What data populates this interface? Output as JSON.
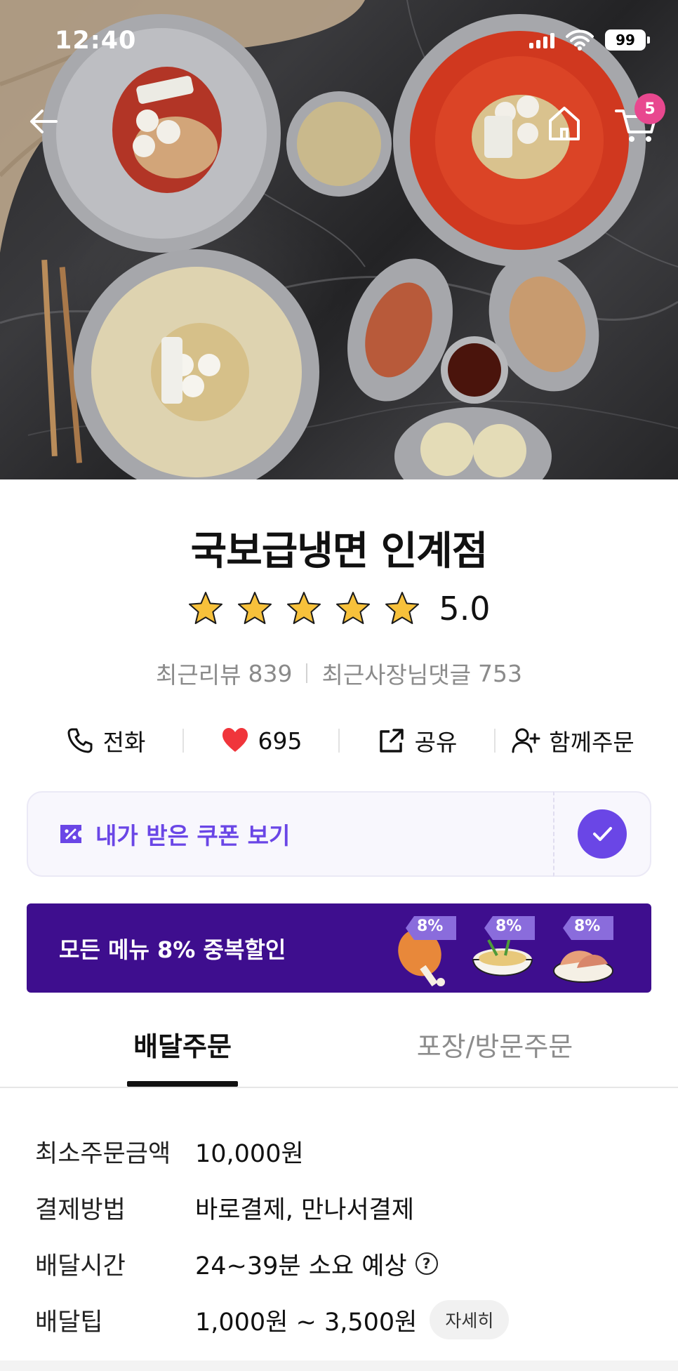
{
  "status_bar": {
    "time": "12:40",
    "battery": "99"
  },
  "nav": {
    "back_icon": "arrow-left-icon",
    "home_icon": "home-icon",
    "cart_icon": "cart-icon",
    "cart_count": "5"
  },
  "hero": {
    "image": "food-photo"
  },
  "store": {
    "name": "국보급냉면 인계점",
    "rating": "5.0",
    "stars": 5,
    "recent_reviews_label": "최근리뷰",
    "recent_reviews_count": "839",
    "owner_replies_label": "최근사장님댓글",
    "owner_replies_count": "753"
  },
  "actions": {
    "call": "전화",
    "likes": "695",
    "share": "공유",
    "group_order": "함께주문"
  },
  "coupon": {
    "label": "내가 받은 쿠폰 보기"
  },
  "promo": {
    "text": "모든 메뉴 8% 중복할인",
    "badge": "8%"
  },
  "tabs": {
    "delivery": "배달주문",
    "pickup": "포장/방문주문"
  },
  "info": [
    {
      "label": "최소주문금액",
      "value": "10,000원"
    },
    {
      "label": "결제방법",
      "value": "바로결제, 만나서결제"
    },
    {
      "label": "배달시간",
      "value": "24~39분 소요 예상"
    },
    {
      "label": "배달팁",
      "value": "1,000원 ~ 3,500원",
      "button": "자세히"
    }
  ],
  "colors": {
    "accent_purple": "#6a46e6",
    "promo_bg": "#3e0e8e",
    "badge_pink": "#e8488f",
    "heart_red": "#f0353b"
  }
}
